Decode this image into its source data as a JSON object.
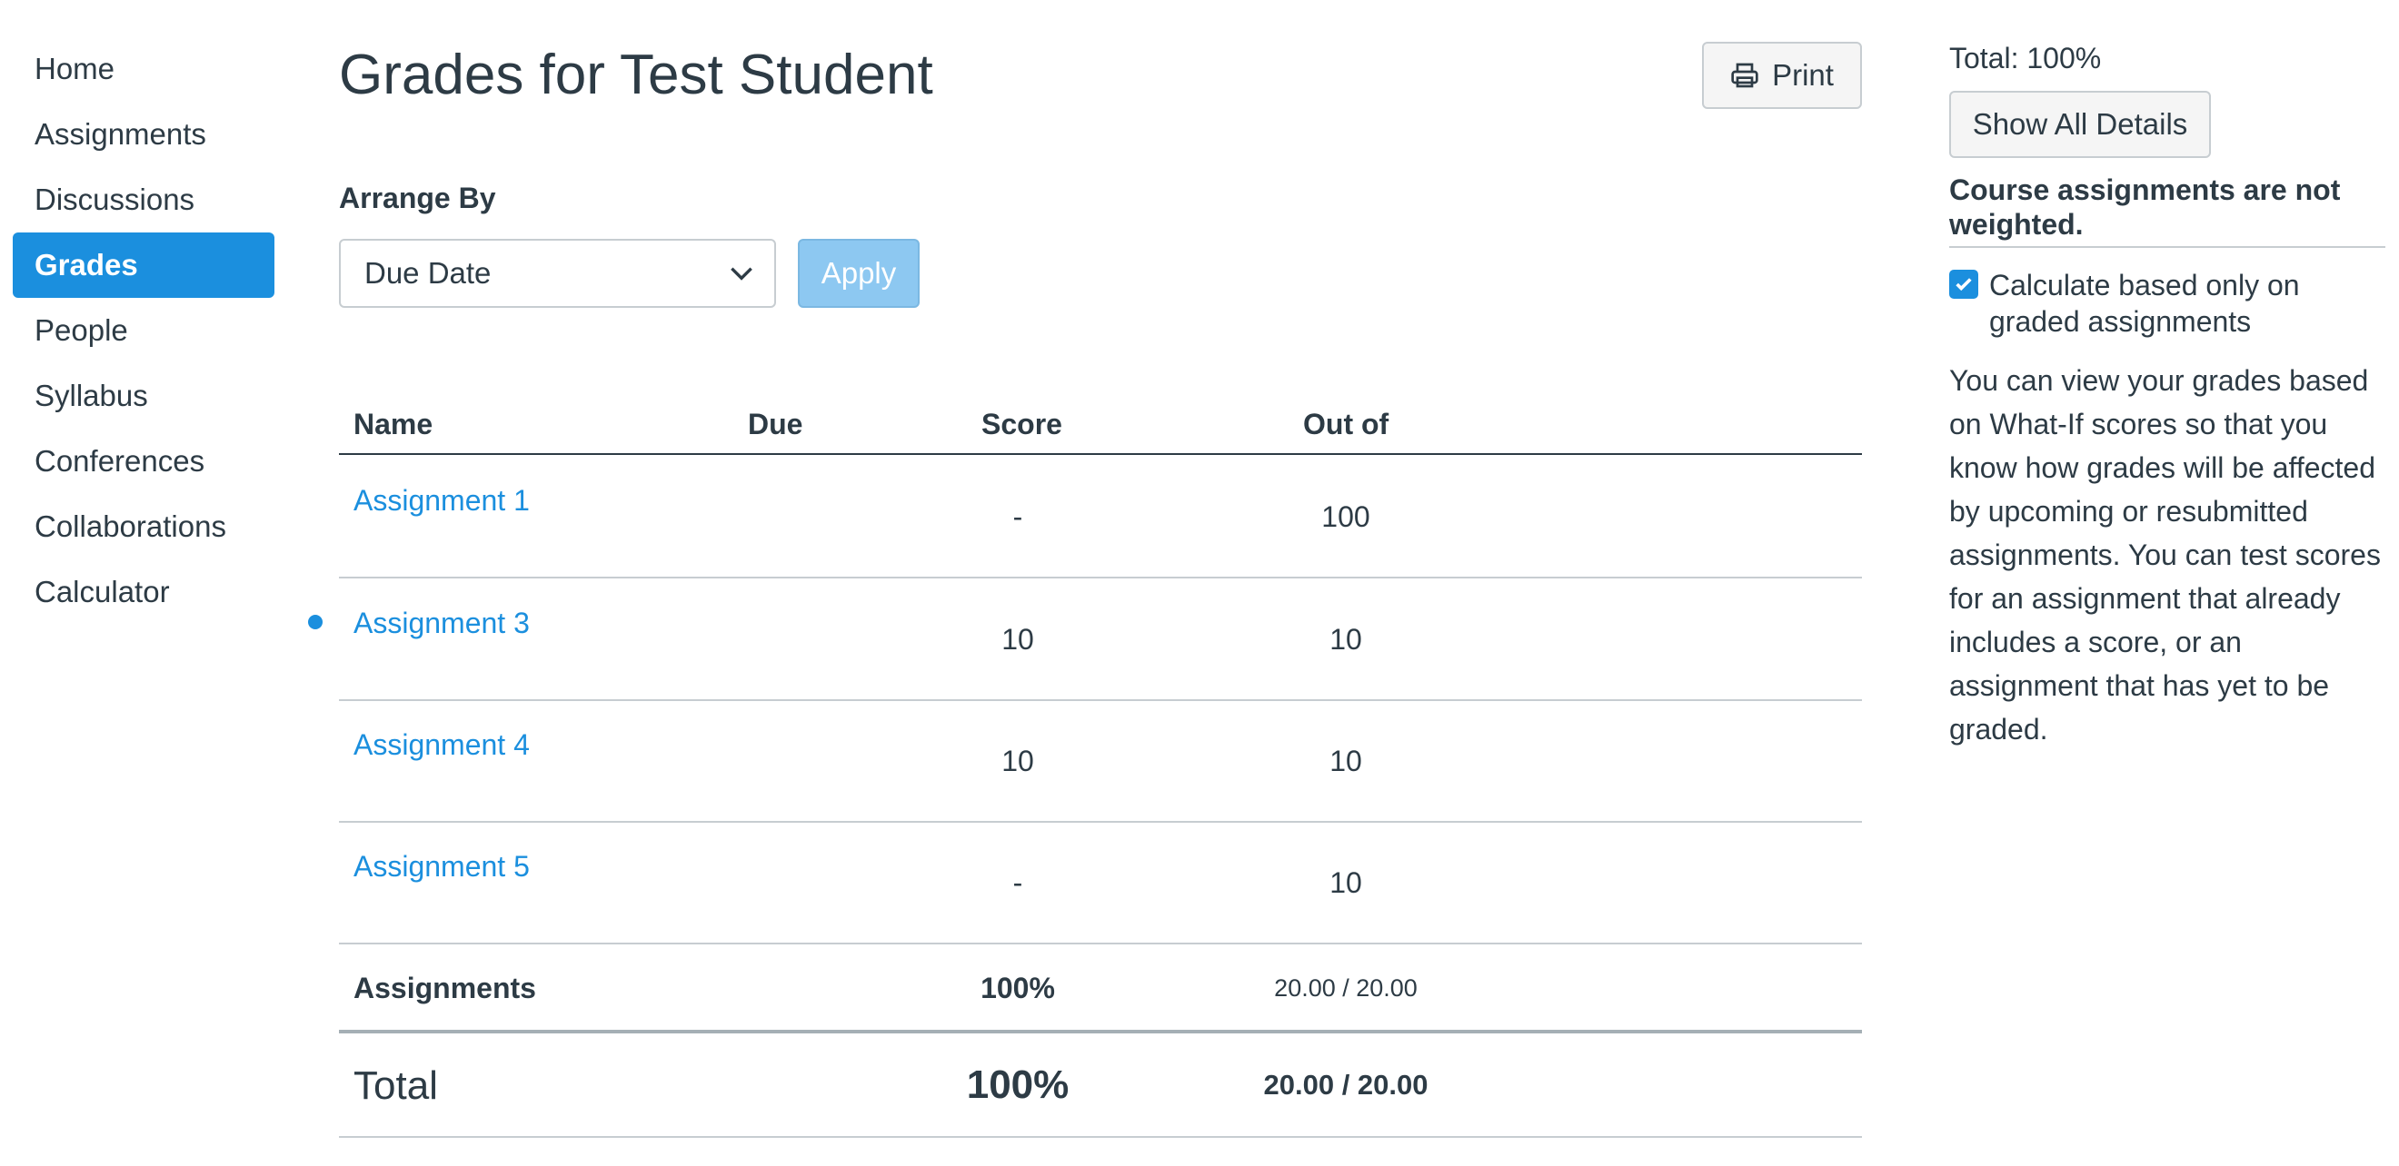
{
  "nav": {
    "items": [
      {
        "label": "Home",
        "active": false
      },
      {
        "label": "Assignments",
        "active": false
      },
      {
        "label": "Discussions",
        "active": false
      },
      {
        "label": "Grades",
        "active": true
      },
      {
        "label": "People",
        "active": false
      },
      {
        "label": "Syllabus",
        "active": false
      },
      {
        "label": "Conferences",
        "active": false
      },
      {
        "label": "Collaborations",
        "active": false
      },
      {
        "label": "Calculator",
        "active": false
      }
    ]
  },
  "header": {
    "title": "Grades for Test Student",
    "print_label": "Print"
  },
  "arrange": {
    "label": "Arrange By",
    "selected": "Due Date",
    "apply_label": "Apply"
  },
  "table": {
    "headers": {
      "name": "Name",
      "due": "Due",
      "score": "Score",
      "out_of": "Out of"
    },
    "rows": [
      {
        "name": "Assignment 1",
        "due": "",
        "score": "-",
        "out_of": "100",
        "unread": false
      },
      {
        "name": "Assignment 3",
        "due": "",
        "score": "10",
        "out_of": "10",
        "unread": true
      },
      {
        "name": "Assignment 4",
        "due": "",
        "score": "10",
        "out_of": "10",
        "unread": false
      },
      {
        "name": "Assignment 5",
        "due": "",
        "score": "-",
        "out_of": "10",
        "unread": false
      }
    ],
    "group_row": {
      "name": "Assignments",
      "score": "100%",
      "out_of": "20.00 / 20.00"
    },
    "total_row": {
      "name": "Total",
      "score": "100%",
      "out_of": "20.00 / 20.00"
    }
  },
  "sidebar_right": {
    "total": "Total: 100%",
    "show_details_label": "Show All Details",
    "weight_note": "Course assignments are not weighted.",
    "checkbox_label": "Calculate based only on graded assignments",
    "checkbox_checked": true,
    "what_if_text": "You can view your grades based on What-If scores so that you know how grades will be affected by upcoming or resubmitted assignments. You can test scores for an assignment that already includes a score, or an assignment that has yet to be graded."
  },
  "colors": {
    "accent": "#1B8FDE",
    "text": "#2D3B45",
    "apply_disabled": "#8DC8F1"
  }
}
